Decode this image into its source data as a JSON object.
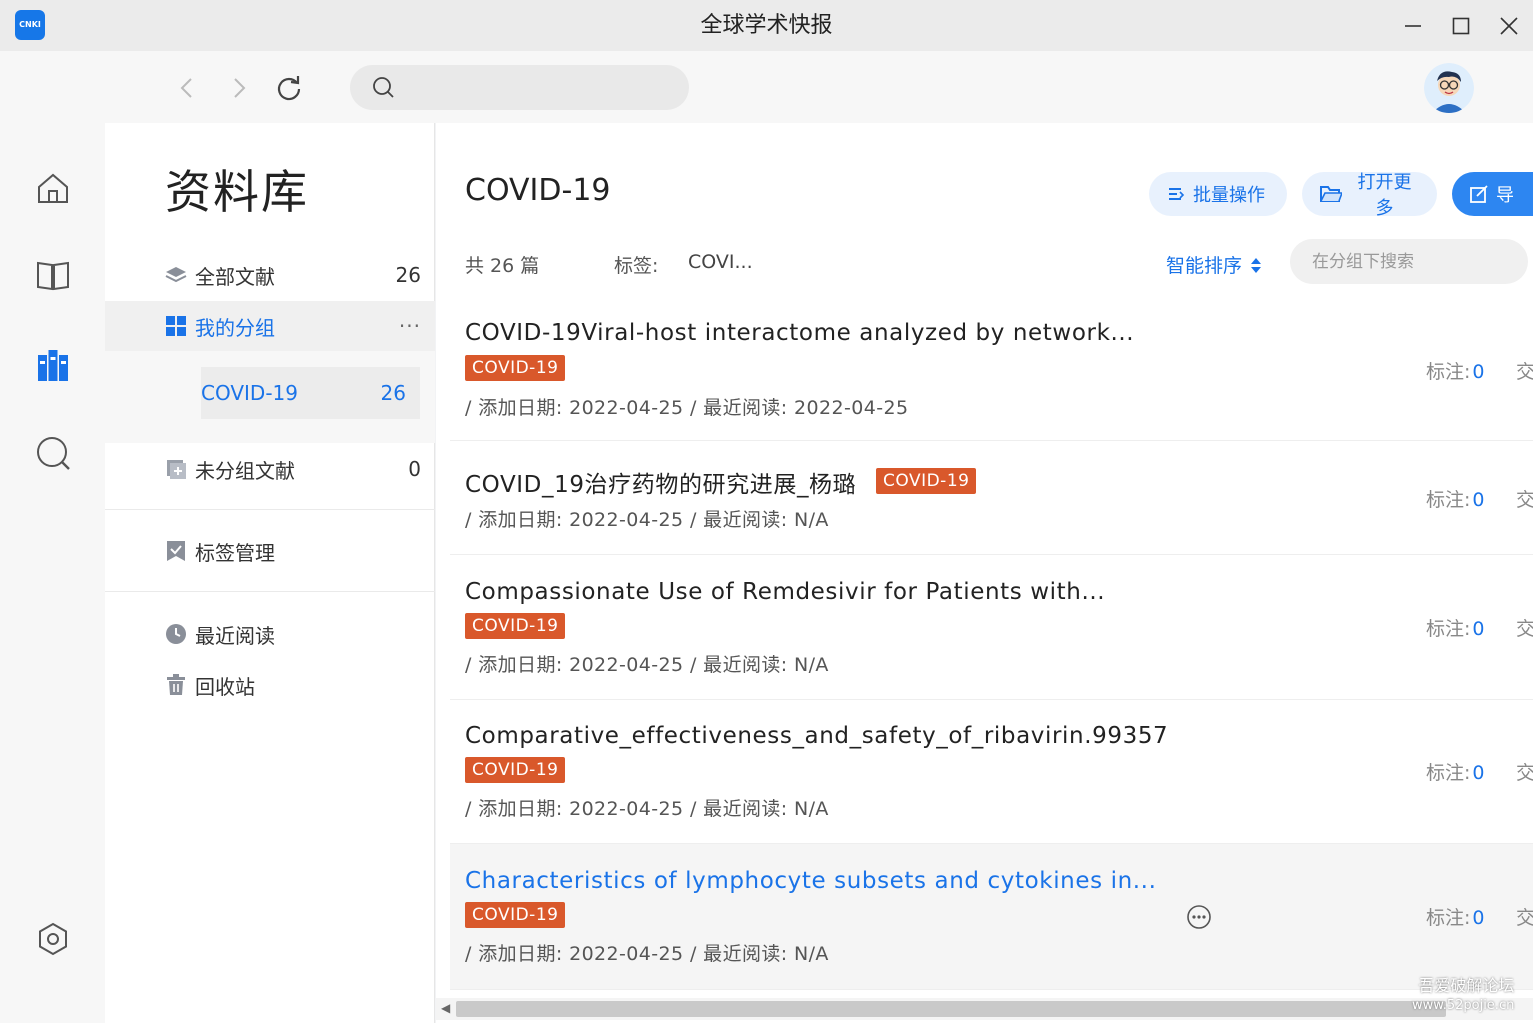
{
  "window": {
    "title": "全球学术快报",
    "logo_text": "CNKI"
  },
  "toolbar": {
    "search_placeholder": ""
  },
  "library": {
    "title": "资料库",
    "items": [
      {
        "label": "全部文献",
        "count": "26"
      },
      {
        "label": "我的分组",
        "count": "···"
      },
      {
        "label": "COVID-19",
        "count": "26"
      },
      {
        "label": "未分组文献",
        "count": "0"
      },
      {
        "label": "标签管理"
      },
      {
        "label": "最近阅读"
      },
      {
        "label": "回收站"
      }
    ]
  },
  "main": {
    "title": "COVID-19",
    "buttons": {
      "batch": "批量操作",
      "open_more": "打开更多",
      "export": "导"
    },
    "total": "共 26 篇",
    "tag_label": "标签:",
    "tag_value": "COVI...",
    "sort_label": "智能排序",
    "group_search_placeholder": "在分组下搜索",
    "documents": [
      {
        "title": "COVID-19Viral-host interactome analyzed by network...",
        "tag": "COVID-19",
        "meta": "/ 添加日期: 2022-04-25 / 最近阅读: 2022-04-25",
        "mark_label": "标注:",
        "mark_count": "0",
        "extra": "交"
      },
      {
        "title": "COVID_19治疗药物的研究进展_杨璐",
        "tag": "COVID-19",
        "meta": "/ 添加日期: 2022-04-25 / 最近阅读: N/A",
        "mark_label": "标注:",
        "mark_count": "0",
        "extra": "交"
      },
      {
        "title": "Compassionate Use of Remdesivir for Patients with...",
        "tag": "COVID-19",
        "meta": "/ 添加日期: 2022-04-25 / 最近阅读: N/A",
        "mark_label": "标注:",
        "mark_count": "0",
        "extra": "交"
      },
      {
        "title": "Comparative_effectiveness_and_safety_of_ribavirin.99357",
        "tag": "COVID-19",
        "meta": "/ 添加日期: 2022-04-25 / 最近阅读: N/A",
        "mark_label": "标注:",
        "mark_count": "0",
        "extra": "交"
      },
      {
        "title": "Characteristics of lymphocyte subsets and cytokines in...",
        "tag": "COVID-19",
        "meta": "/ 添加日期: 2022-04-25 / 最近阅读: N/A",
        "mark_label": "标注:",
        "mark_count": "0",
        "extra": "交"
      }
    ]
  },
  "watermark": {
    "line1": "吾爱破解论坛",
    "line2": "www.52pojie.cn"
  },
  "colors": {
    "accent": "#1a73e8",
    "tag": "#d9582b",
    "logo": "#1677e8"
  }
}
